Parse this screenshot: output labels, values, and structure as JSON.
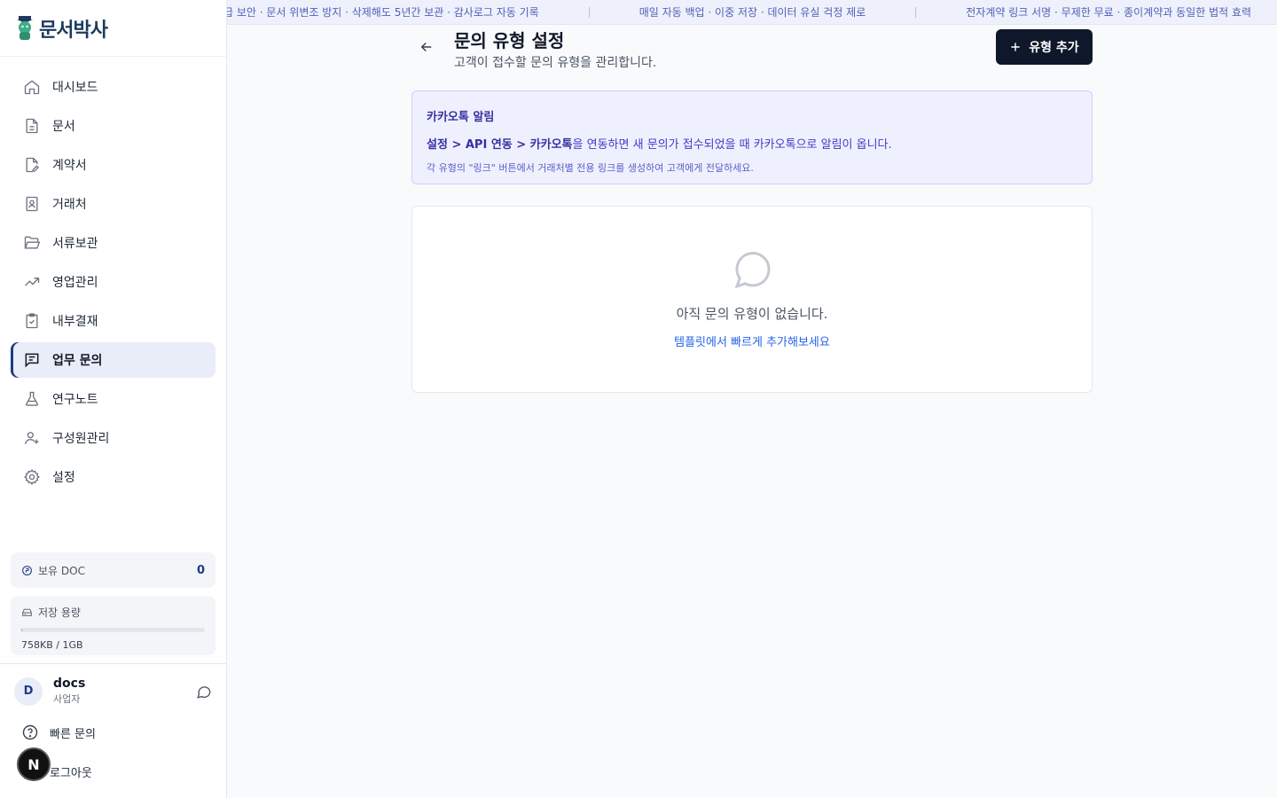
{
  "app": {
    "name": "문서박사"
  },
  "ticker": {
    "items": [
      "급 보안 · 문서 위변조 방지 · 삭제해도 5년간 보관 · 감사로그 자동 기록",
      "매일 자동 백업 · 이중 저장 · 데이터 유실 걱정 제로",
      "전자계약 링크 서명 · 무제한 무료 · 종이계약과 동일한 법적 효력"
    ]
  },
  "sidebar": {
    "items": [
      {
        "label": "대시보드",
        "icon": "home-icon"
      },
      {
        "label": "문서",
        "icon": "file-text-icon"
      },
      {
        "label": "계약서",
        "icon": "file-pen-icon"
      },
      {
        "label": "거래처",
        "icon": "contact-book-icon"
      },
      {
        "label": "서류보관",
        "icon": "folder-open-icon"
      },
      {
        "label": "영업관리",
        "icon": "trending-up-icon"
      },
      {
        "label": "내부결재",
        "icon": "clipboard-check-icon"
      },
      {
        "label": "업무 문의",
        "icon": "message-square-text-icon",
        "active": true
      },
      {
        "label": "연구노트",
        "icon": "flask-icon"
      },
      {
        "label": "구성원관리",
        "icon": "user-plus-icon"
      },
      {
        "label": "설정",
        "icon": "gear-icon"
      }
    ],
    "doc": {
      "label": "보유 DOC",
      "value": "0"
    },
    "storage": {
      "label": "저장 용량",
      "value": "758KB / 1GB",
      "used_fraction": 0.0007
    },
    "user": {
      "initial": "D",
      "name": "docs",
      "role": "사업자"
    },
    "quick_help": "빠른 문의",
    "logout": "로그아웃",
    "n_badge": "N"
  },
  "page": {
    "title": "문의 유형 설정",
    "subtitle": "고객이 접수할 문의 유형을 관리합니다.",
    "add_button": "유형 추가"
  },
  "info": {
    "title": "카카오톡 알림",
    "path_strong": "설정 > API 연동 > 카카오톡",
    "path_rest": "을 연동하면 새 문의가 접수되었을 때 카카오톡으로 알림이 옵니다.",
    "hint": "각 유형의 \"링크\" 버튼에서 거래처별 전용 링크를 생성하여 고객에게 전달하세요."
  },
  "empty": {
    "message": "아직 문의 유형이 없습니다.",
    "link": "템플릿에서 빠르게 추가해보세요"
  },
  "colors": {
    "accent": "#1e3a8a",
    "primary_button": "#0f172a",
    "info_bg": "#eef1fd",
    "link": "#2563eb"
  }
}
